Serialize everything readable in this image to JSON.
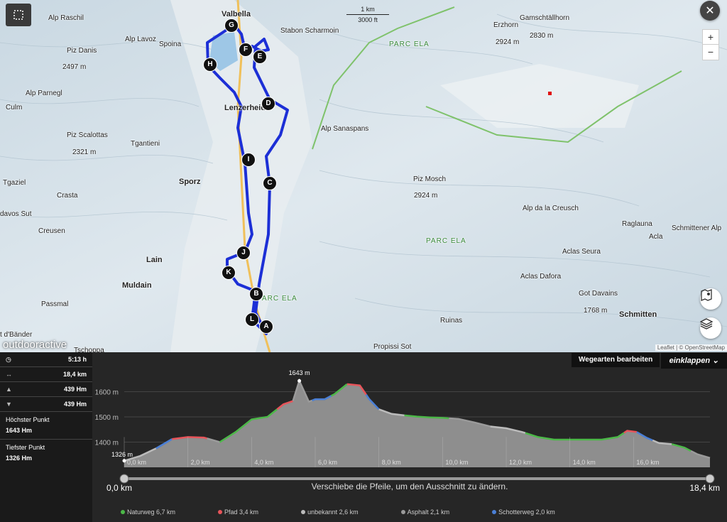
{
  "map": {
    "brand": "outdooractive",
    "attribution": "Leaflet | © OpenStreetMap",
    "scale": {
      "top": "1 km",
      "bottom": "3000 ft"
    },
    "zoom_in": "+",
    "zoom_out": "−",
    "labels": [
      {
        "text": "Valbella",
        "bold": true
      },
      {
        "text": "Alp Raschil"
      },
      {
        "text": "Alp Lavoz"
      },
      {
        "text": "Spoina"
      },
      {
        "text": "Piz Danis"
      },
      {
        "text": "2497 m"
      },
      {
        "text": "Alp Parnegl"
      },
      {
        "text": "Culm"
      },
      {
        "text": "Lenzerheide",
        "bold": true
      },
      {
        "text": "Piz Scalottas"
      },
      {
        "text": "2321 m"
      },
      {
        "text": "Tgantieni"
      },
      {
        "text": "Sporz",
        "bold": true
      },
      {
        "text": "Tgaziel"
      },
      {
        "text": "Crasta"
      },
      {
        "text": "davos Sut"
      },
      {
        "text": "Creusen"
      },
      {
        "text": "Lain",
        "bold": true
      },
      {
        "text": "Muldain",
        "bold": true
      },
      {
        "text": "Passmal"
      },
      {
        "text": "Tschoppa"
      },
      {
        "text": "t d'Bänder"
      },
      {
        "text": "Stabon Scharmoin"
      },
      {
        "text": "PARC ELA",
        "park": true
      },
      {
        "text": "Gamschtällhorn"
      },
      {
        "text": "2830 m"
      },
      {
        "text": "Erzhorn"
      },
      {
        "text": "2924 m"
      },
      {
        "text": "Alp Sanaspans"
      },
      {
        "text": "Piz Mosch"
      },
      {
        "text": "2924 m"
      },
      {
        "text": "Alp da la Creusch"
      },
      {
        "text": "Raglauna"
      },
      {
        "text": "Schmittener Alp"
      },
      {
        "text": "PARC ELA",
        "park": true
      },
      {
        "text": "Acla"
      },
      {
        "text": "Aclas Seura"
      },
      {
        "text": "Aclas Dafora"
      },
      {
        "text": "Got Davains"
      },
      {
        "text": "1768 m"
      },
      {
        "text": "Ruinas"
      },
      {
        "text": "Schmitten",
        "bold": true
      },
      {
        "text": "Propissi Sot"
      },
      {
        "text": "PARC ELA",
        "park": true
      }
    ],
    "waypoints": [
      "G",
      "F",
      "E",
      "H",
      "D",
      "I",
      "C",
      "J",
      "K",
      "B",
      "L",
      "A"
    ]
  },
  "stats": {
    "duration": "5:13 h",
    "distance": "18,4 km",
    "ascent": "439 Hm",
    "descent": "439 Hm",
    "highest_label": "Höchster Punkt",
    "highest_value": "1643 Hm",
    "lowest_label": "Tiefster Punkt",
    "lowest_value": "1326 Hm"
  },
  "profile": {
    "edit_button": "Wegearten bearbeiten",
    "collapse_button": "einklappen",
    "hint": "Verschiebe die Pfeile, um den Ausschnitt zu ändern.",
    "range_start": "0,0 km",
    "range_end": "18,4 km",
    "max_label": "1643 m",
    "min_label": "1326 m"
  },
  "chart_data": {
    "type": "area",
    "xlabel": "",
    "ylabel": "",
    "xlim": [
      0,
      18.4
    ],
    "ylim": [
      1300,
      1700
    ],
    "y_ticks": [
      "1400 m",
      "1500 m",
      "1600 m"
    ],
    "y_tick_values": [
      1400,
      1500,
      1600
    ],
    "x_ticks": [
      "0,0 km",
      "2,0 km",
      "4,0 km",
      "6,0 km",
      "8,0 km",
      "10,0 km",
      "12,0 km",
      "14,0 km",
      "16,0 km"
    ],
    "x_tick_values": [
      0,
      2,
      4,
      6,
      8,
      10,
      12,
      14,
      16
    ],
    "x": [
      0,
      0.5,
      1.0,
      1.5,
      2.0,
      2.5,
      3.0,
      3.5,
      4.0,
      4.5,
      5.0,
      5.3,
      5.5,
      5.8,
      6.0,
      6.3,
      6.6,
      7.0,
      7.4,
      7.7,
      8.0,
      8.4,
      8.8,
      9.2,
      9.6,
      10.0,
      10.5,
      11.0,
      11.5,
      12.0,
      12.5,
      13.0,
      13.5,
      14.0,
      14.5,
      15.0,
      15.5,
      15.8,
      16.1,
      16.4,
      16.8,
      17.2,
      17.6,
      18.0,
      18.4
    ],
    "y": [
      1326,
      1345,
      1375,
      1412,
      1420,
      1418,
      1400,
      1440,
      1490,
      1500,
      1550,
      1563,
      1643,
      1560,
      1570,
      1570,
      1590,
      1630,
      1625,
      1570,
      1530,
      1512,
      1506,
      1501,
      1498,
      1496,
      1492,
      1478,
      1462,
      1455,
      1440,
      1420,
      1410,
      1410,
      1410,
      1410,
      1420,
      1445,
      1440,
      1418,
      1396,
      1392,
      1378,
      1352,
      1337
    ],
    "surface_types": [
      {
        "name": "Naturweg 6,7 km",
        "color": "#4cb848"
      },
      {
        "name": "Pfad 3,4 km",
        "color": "#e8545a"
      },
      {
        "name": "unbekannt 2,6 km",
        "color": "#bbbbbb"
      },
      {
        "name": "Asphalt 2,1 km",
        "color": "#9a9a9a"
      },
      {
        "name": "Schotterweg 2,0 km",
        "color": "#4a7fd6"
      }
    ],
    "segments": [
      {
        "from": 0.0,
        "to": 1.0,
        "surface": 2
      },
      {
        "from": 1.0,
        "to": 1.5,
        "surface": 4
      },
      {
        "from": 1.5,
        "to": 2.6,
        "surface": 1
      },
      {
        "from": 2.6,
        "to": 3.0,
        "surface": 3
      },
      {
        "from": 3.0,
        "to": 4.8,
        "surface": 0
      },
      {
        "from": 4.8,
        "to": 5.3,
        "surface": 1
      },
      {
        "from": 5.3,
        "to": 5.9,
        "surface": 3
      },
      {
        "from": 5.9,
        "to": 6.5,
        "surface": 4
      },
      {
        "from": 6.5,
        "to": 7.0,
        "surface": 0
      },
      {
        "from": 7.0,
        "to": 7.6,
        "surface": 1
      },
      {
        "from": 7.6,
        "to": 8.0,
        "surface": 4
      },
      {
        "from": 8.0,
        "to": 8.8,
        "surface": 2
      },
      {
        "from": 8.8,
        "to": 10.2,
        "surface": 0
      },
      {
        "from": 10.2,
        "to": 11.5,
        "surface": 3
      },
      {
        "from": 11.5,
        "to": 12.6,
        "surface": 2
      },
      {
        "from": 12.6,
        "to": 15.7,
        "surface": 0
      },
      {
        "from": 15.7,
        "to": 16.1,
        "surface": 1
      },
      {
        "from": 16.1,
        "to": 16.6,
        "surface": 4
      },
      {
        "from": 16.6,
        "to": 17.2,
        "surface": 2
      },
      {
        "from": 17.2,
        "to": 17.8,
        "surface": 0
      },
      {
        "from": 17.8,
        "to": 18.4,
        "surface": 3
      }
    ]
  }
}
